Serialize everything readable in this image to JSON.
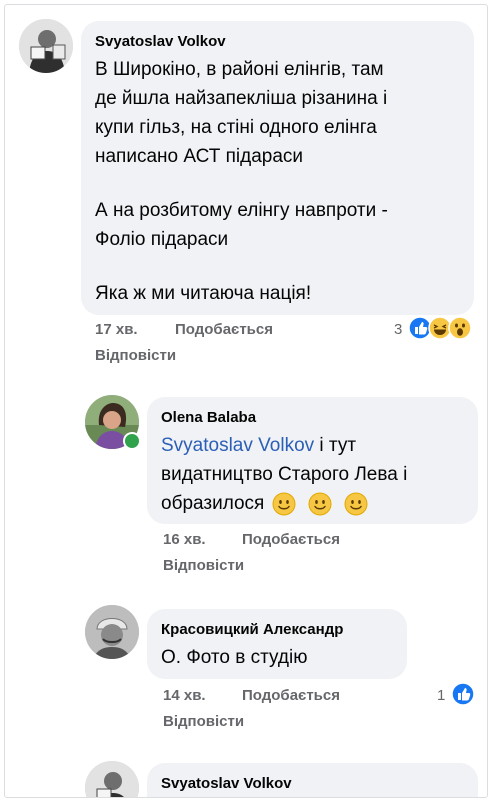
{
  "comments": [
    {
      "author": "Svyatoslav Volkov",
      "lines": [
        "В Широкіно, в районі елінгів, там",
        "де йшла найзапекліша різанина і",
        "купи гільз, на стіні одного елінга",
        "написано АСТ підараси",
        "",
        "А на розбитому елінгу навпроти -",
        "Фоліо підараси",
        "",
        "Яка ж ми читаюча нація!"
      ],
      "time": "17 хв.",
      "like_label": "Подобається",
      "reply_label": "Відповісти",
      "reaction_count": "3",
      "reactions": [
        "like",
        "haha",
        "wow"
      ]
    },
    {
      "author": "Olena Balaba",
      "mention": "Svyatoslav Volkov",
      "line1_rest": " і тут",
      "line2": "видатництво Старого Лева і",
      "line3": "образилося",
      "emojis": [
        "smile",
        "smile",
        "smile"
      ],
      "time": "16 хв.",
      "like_label": "Подобається",
      "reply_label": "Відповісти",
      "online": true
    },
    {
      "author": "Красовицкий Александр",
      "text": "О. Фото в студію",
      "time": "14 хв.",
      "like_label": "Подобається",
      "reply_label": "Відповісти",
      "reaction_count": "1",
      "reactions": [
        "like"
      ]
    },
    {
      "author": "Svyatoslav Volkov"
    }
  ],
  "colors": {
    "bubble": "#f0f2f5",
    "meta": "#65676b",
    "mention": "#2b5fb6",
    "like_blue": "#1877f2",
    "online": "#31a24c"
  }
}
